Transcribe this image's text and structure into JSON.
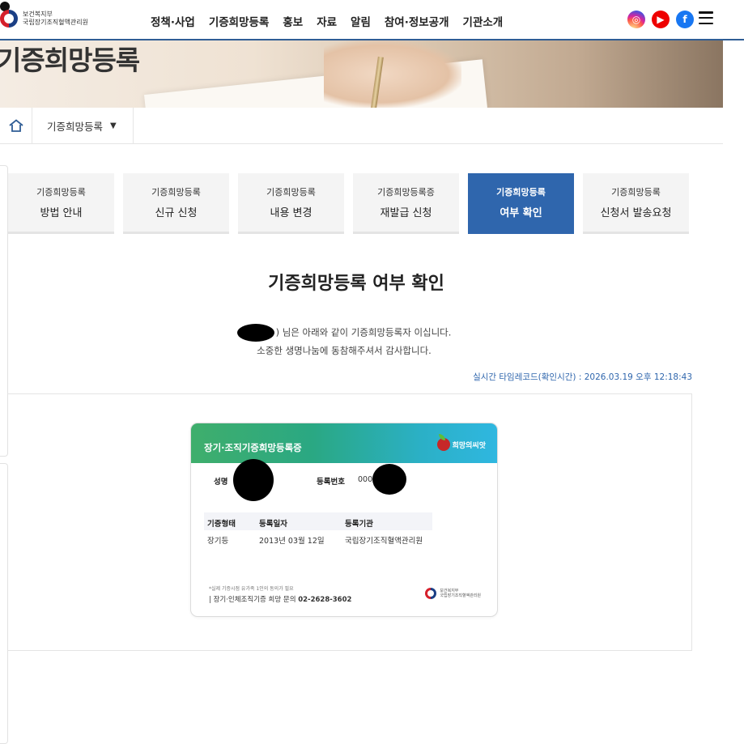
{
  "header": {
    "org_line1": "보건복지부",
    "org_line2": "국립장기조직혈액관리원",
    "nav": [
      "정책·사업",
      "기증희망등록",
      "홍보",
      "자료",
      "알림",
      "참여·정보공개",
      "기관소개"
    ],
    "sns": [
      {
        "name": "instagram-icon",
        "glyph": "◎"
      },
      {
        "name": "youtube-icon",
        "glyph": "▶"
      },
      {
        "name": "facebook-icon",
        "glyph": "f"
      }
    ]
  },
  "banner": {
    "title": "기증희망등록"
  },
  "breadcrumb": {
    "current": "기증희망등록",
    "caret": "▼"
  },
  "tabs": [
    {
      "l1": "기증희망등록",
      "l2": "방법 안내",
      "active": false
    },
    {
      "l1": "기증희망등록",
      "l2": "신규 신청",
      "active": false
    },
    {
      "l1": "기증희망등록",
      "l2": "내용 변경",
      "active": false
    },
    {
      "l1": "기증희망등록증",
      "l2": "재발급 신청",
      "active": false
    },
    {
      "l1": "기증희망등록",
      "l2": "여부 확인",
      "active": true
    },
    {
      "l1": "기증희망등록",
      "l2": "신청서 발송요청",
      "active": false
    }
  ],
  "content": {
    "title": "기증희망등록 여부 확인",
    "message_line1": ") 님은 아래와 같이 기증희망등록자 이십니다.",
    "message_line2": "소중한 생명나눔에 동참해주셔서 감사합니다.",
    "timestamp": "실시간 타임레코드(확인시간) : 2026.03.19 오후 12:18:43"
  },
  "card": {
    "title": "장기·조직기증희망등록증",
    "brand": "희망의씨앗",
    "name_label": "성명",
    "reg_no_label": "등록번호",
    "reg_no_value": "000",
    "col_type_label": "기증형태",
    "col_date_label": "등록일자",
    "col_org_label": "등록기관",
    "type_value": "장기등",
    "date_value": "2013년 03월 12일",
    "org_value": "국립장기조직혈액관리원",
    "foot_note": "*실제 기증시점 유가족 1인의 동의가 필요",
    "foot_text": "| 장기·인체조직기증 희망 문의",
    "foot_phone": "02-2628-3602",
    "logo_line1": "보건복지부",
    "logo_line2": "국립장기조직혈액관리원"
  },
  "colors": {
    "accent": "#2f66ad",
    "header_rule": "#2f5d95"
  }
}
